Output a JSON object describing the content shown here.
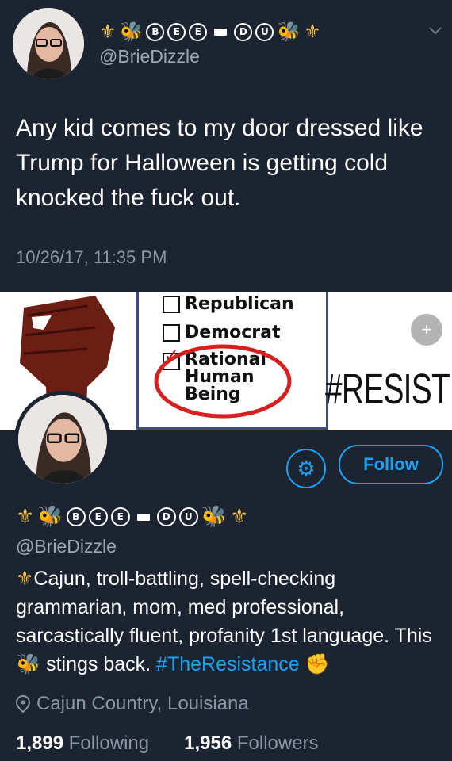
{
  "tweet": {
    "display_name_emojis": [
      "⚜",
      "🐝",
      "B",
      "E",
      "E",
      "-",
      "D",
      "U",
      "🐝",
      "⚜"
    ],
    "handle": "@BrieDizzle",
    "text": "Any kid comes to my door dressed like Trump for Halloween is getting cold knocked the fuck out.",
    "timestamp": "10/26/17, 11:35 PM"
  },
  "banner": {
    "ballot_options": [
      "Republican",
      "Democrat",
      "Rational",
      "Human",
      "Being"
    ],
    "hashtag": "#RESIST"
  },
  "profile": {
    "handle": "@BrieDizzle",
    "follow_label": "Follow",
    "bio_part1": "Cajun, troll-battling, spell-checking grammarian, mom, med professional, sarcastically fluent, profanity 1st language. This ",
    "bio_part2": " stings back. ",
    "bio_hashtag": "#TheResistance",
    "location": "Cajun Country, Louisiana",
    "following_count": "1,899",
    "following_label": "Following",
    "followers_count": "1,956",
    "followers_label": "Followers"
  },
  "colors": {
    "background": "#1b2430",
    "accent": "#1da1f2",
    "muted": "#8899a6"
  }
}
